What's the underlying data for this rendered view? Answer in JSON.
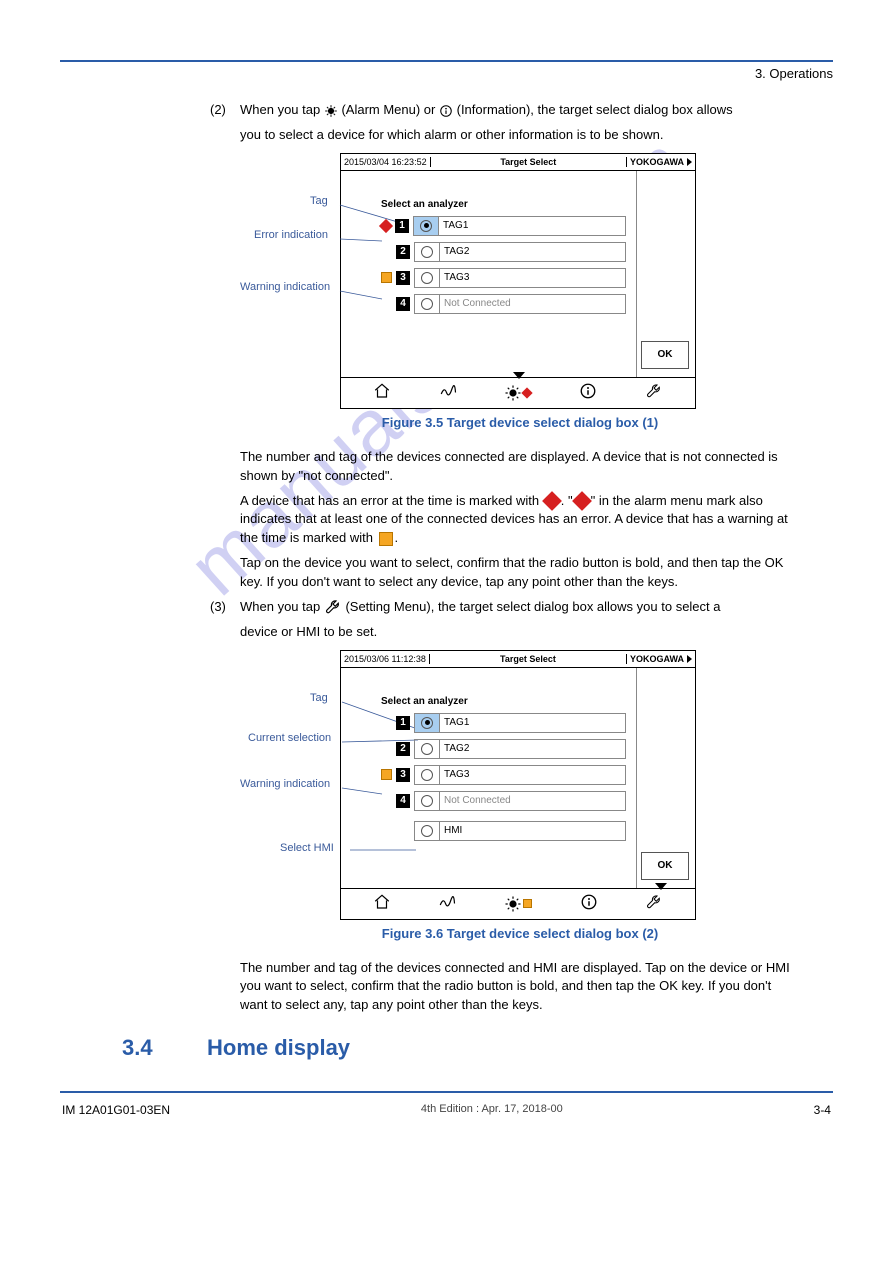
{
  "header": {
    "section_ref": "3. Operations"
  },
  "p1": {
    "num": "(2)",
    "text_a": "When you tap ",
    "text_b": " (Alarm Menu) or ",
    "text_c": " (Information), the target select dialog box allows"
  },
  "p2": "you to select a device for which alarm or other information is to be shown.",
  "fig1": {
    "timestamp": "2015/03/04 16:23:52",
    "title": "Target Select",
    "brand": "YOKOGAWA",
    "prompt": "Select an analyzer",
    "rows": [
      {
        "n": "1",
        "tag": "TAG1",
        "sel": true,
        "icon": "red"
      },
      {
        "n": "2",
        "tag": "TAG2",
        "sel": false,
        "icon": ""
      },
      {
        "n": "3",
        "tag": "TAG3",
        "sel": false,
        "icon": "orange"
      },
      {
        "n": "4",
        "tag": "Not Connected",
        "sel": false,
        "icon": "",
        "nc": true
      }
    ],
    "ok": "OK",
    "callouts": {
      "c1": "Tag",
      "c2": "Error indication",
      "c3": "Warning indication"
    }
  },
  "fig1_caption": "Figure 3.5  Target device select dialog box (1)",
  "para_a1": "The number and tag of the devices connected are displayed. A device that is not connected is shown by \"not connected\".",
  "para_a2": "A device that has an error at the time is marked with  . \"  \" in the alarm menu mark also indicates that at least one of the connected devices has an error. A device that has a warning at the time is marked with  .",
  "para_a3": "Tap on the device you want to select, confirm that the radio button is bold, and then tap the OK key. If you don't want to select any device, tap any point other than the keys.",
  "p3": {
    "num": "(3)",
    "text_a": "When you tap ",
    "text_b": " (Setting Menu), the target select dialog box allows you to select a"
  },
  "p4": "device or HMI to be set.",
  "fig2": {
    "timestamp": "2015/03/06 11:12:38",
    "title": "Target Select",
    "brand": "YOKOGAWA",
    "prompt": "Select an analyzer",
    "rows": [
      {
        "n": "1",
        "tag": "TAG1",
        "sel": true,
        "icon": ""
      },
      {
        "n": "2",
        "tag": "TAG2",
        "sel": false,
        "icon": ""
      },
      {
        "n": "3",
        "tag": "TAG3",
        "sel": false,
        "icon": "orange"
      },
      {
        "n": "4",
        "tag": "Not Connected",
        "sel": false,
        "icon": "",
        "nc": true
      }
    ],
    "hmi": "HMI",
    "ok": "OK",
    "callouts": {
      "c1": "Tag",
      "c2": "Current selection",
      "c3": "Warning indication",
      "c4": "Select HMI"
    }
  },
  "fig2_caption": "Figure 3.6  Target device select dialog box (2)",
  "para_b1": "The number and tag of the devices connected and HMI are displayed. Tap on the device or HMI you want to select, confirm that the radio button is bold, and then tap the OK key. If you don't want to select any, tap any point other than the keys.",
  "footer": {
    "left": "IM 12A01G01-03EN",
    "mid": "4th Edition : Apr. 17, 2018-00",
    "right": "3-4"
  }
}
